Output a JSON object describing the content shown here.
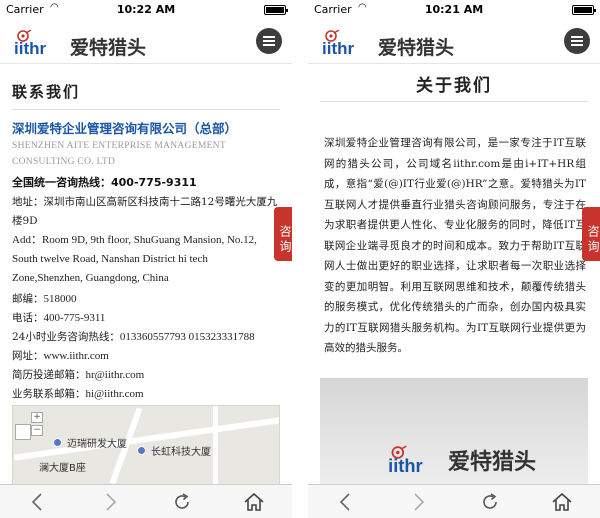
{
  "left_screen": {
    "status": {
      "carrier": "Carrier",
      "time": "10:22 AM"
    },
    "header": {
      "brand": "爱特猎头",
      "logo_word": "iithr"
    },
    "section_title": "联系我们",
    "company_name": "深圳爱特企业管理咨询有限公司（总部）",
    "company_name_en": "SHENZHEN AITE ENTERPRISE MANAGEMENT CONSULTING CO. LTD",
    "hotline": "全国统一咨询热线：400-775-9311",
    "address_cn": "地址：深圳市南山区高新区科技南十二路12号曙光大厦九楼9D",
    "address_en": "Add：Room 9D, 9th floor, ShuGuang Mansion, No.12, South twelve Road, Nanshan District hi tech Zone,Shenzhen, Guangdong, China",
    "zip_label": "邮编：",
    "zip": "518000",
    "phone_label": "电话：",
    "phone": "400-775-9311",
    "service_label": "24小时业务咨询热线：",
    "service": "013360557793  015323331788",
    "site_label": "网址：",
    "site": "www.iithr.com",
    "resume_label": "简历投递邮箱：",
    "resume": "hr@iithr.com",
    "biz_label": "业务联系邮箱：",
    "biz": "hi@iithr.com",
    "map": {
      "label_a": "迈瑞研发大厦",
      "label_b": "长虹科技大厦",
      "label_c": "澜大厦B座"
    },
    "side_tab": "咨询"
  },
  "right_screen": {
    "status": {
      "carrier": "Carrier",
      "time": "10:21 AM"
    },
    "header": {
      "brand": "爱特猎头",
      "logo_word": "iithr"
    },
    "title": "关于我们",
    "body": "深圳爱特企业管理咨询有限公司，是一家专注于IT互联网的猎头公司，公司域名iithr.com是由i+IT+HR组成，意指“爱(@)IT行业爱(@)HR”之意。爱特猎头为IT互联网人才提供垂直行业猎头咨询顾问服务，专注于在为求职者提供更人性化、专业化服务的同时，降低IT互联网企业端寻觅良才的时间和成本。致力于帮助IT互联网人士做出更好的职业选择，让求职者每一次职业选择变的更加明智。利用互联网思维和技术，颠覆传统猎头的服务模式，优化传统猎头的广而杂，创办国内极具实力的IT互联网猎头服务机构。为IT互联网行业提供更为高效的猎头服务。",
    "image_brand": "爱特猎头",
    "side_tab": "咨询"
  },
  "colors": {
    "accent_red": "#c8332b",
    "link_blue": "#1a55a8",
    "menu_dark": "#3d3d3d"
  },
  "icons": [
    "back-icon",
    "forward-icon",
    "refresh-icon",
    "home-icon",
    "menu-icon",
    "wifi-icon",
    "battery-icon"
  ]
}
